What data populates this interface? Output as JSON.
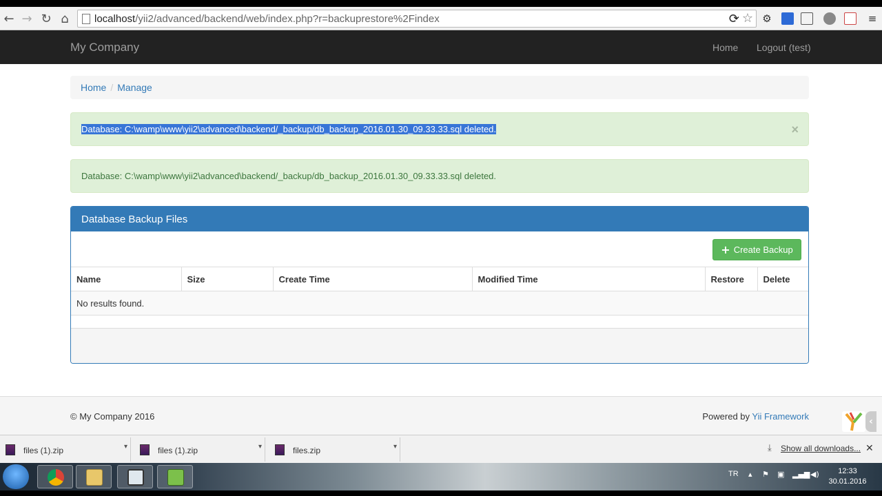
{
  "browser": {
    "url_host": "localhost",
    "url_path": "/yii2/advanced/backend/web/index.php?r=backuprestore%2Findex"
  },
  "navbar": {
    "brand": "My Company",
    "links": [
      "Home",
      "Logout (test)"
    ]
  },
  "breadcrumb": [
    "Home",
    "Manage"
  ],
  "alerts": [
    "Database: C:\\wamp\\www\\yii2\\advanced\\backend/_backup/db_backup_2016.01.30_09.33.33.sql deleted.",
    "Database: C:\\wamp\\www\\yii2\\advanced\\backend/_backup/db_backup_2016.01.30_09.33.33.sql deleted."
  ],
  "alert_close": "×",
  "panel": {
    "title": "Database Backup Files",
    "create_button": "Create Backup",
    "columns": [
      "Name",
      "Size",
      "Create Time",
      "Modified Time",
      "Restore",
      "Delete"
    ],
    "empty_text": "No results found."
  },
  "footer": {
    "copyright": "© My Company 2016",
    "powered_prefix": "Powered by ",
    "powered_link": "Yii Framework"
  },
  "downloads": {
    "items": [
      "files (1).zip",
      "files (1).zip",
      "files.zip"
    ],
    "show_all": "Show all downloads..."
  },
  "taskbar": {
    "lang": "TR",
    "time": "12:33",
    "date": "30.01.2016"
  },
  "colors": {
    "navbar": "#222222",
    "primary": "#337ab7",
    "success_bg": "#dff0d8",
    "success_text": "#3c763d",
    "button_green": "#5cb85c"
  }
}
